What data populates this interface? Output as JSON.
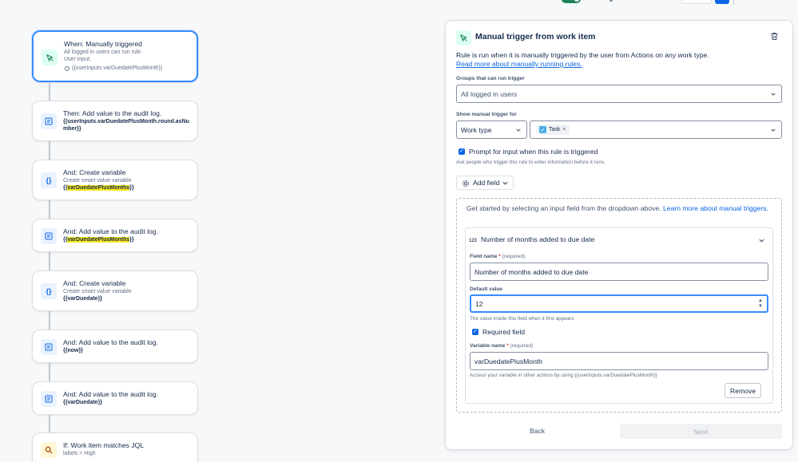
{
  "colors": {
    "accent": "#0c66e4",
    "selected_border": "#388bff",
    "highlight": "#f8e71c",
    "trigger_icon_bg": "#dcfff1",
    "action_icon_bg": "#e9f2ff",
    "condition_icon_bg": "#fff7d6"
  },
  "flow": {
    "cards": [
      {
        "icon": "trigger-icon",
        "title": "When: Manually triggered",
        "line1": "All logged in users can run rule.",
        "line2": "User input:",
        "bullet": "{{userInputs.varDuedatePlusMonth}}"
      },
      {
        "icon": "audit-log-icon",
        "title": "Then: Add value to the audit log.",
        "code": "{{userInputs.varDuedatePlusMonth.round.asNumber}}"
      },
      {
        "icon": "variable-icon",
        "title": "And: Create variable",
        "sub": "Create smart value variable",
        "code_pre": "{{",
        "code_hl": "varDuedatePlusMonths",
        "code_post": "}}"
      },
      {
        "icon": "audit-log-icon",
        "title": "And: Add value to the audit log.",
        "code_pre": "{{",
        "code_hl": "varDuedatePlusMonths",
        "code_post": "}}"
      },
      {
        "icon": "variable-icon",
        "title": "And: Create variable",
        "sub": "Create smart value variable",
        "code": "{{varDuedate}}"
      },
      {
        "icon": "audit-log-icon",
        "title": "And: Add value to the audit log.",
        "code": "{{now}}"
      },
      {
        "icon": "audit-log-icon",
        "title": "And: Add value to the audit log.",
        "code": "{{varDuedate}}"
      },
      {
        "icon": "search-condition-icon",
        "title": "If: Work item matches JQL",
        "sub": "labels = High"
      }
    ]
  },
  "panel": {
    "icon": "trigger-icon",
    "title": "Manual trigger from work item",
    "description": "Rule is run when it is manually triggered by the user from Actions on any work type.",
    "read_more_link": "Read more about manually running rules.",
    "groups_label": "Groups that can run trigger",
    "groups_value": "All logged in users",
    "show_for_label": "Show manual trigger for",
    "show_for_type": "Work type",
    "show_for_chip": "Task",
    "prompt_checkbox_label": "Prompt for input when this rule is triggered",
    "prompt_helper": "Ask people who trigger this rule to enter information before it runs.",
    "add_field_label": "Add field",
    "intro_text": "Get started by selecting an input field from the dropdown above.",
    "intro_link": "Learn more about manual triggers.",
    "field": {
      "type_icon": "123",
      "header": "Number of months added to due date",
      "name_label": "Field name",
      "name_required": "*",
      "name_optional": "(required)",
      "name_value": "Number of months added to due date",
      "default_label": "Default value",
      "default_value": "12",
      "default_helper": "The value inside this field when it first appears",
      "required_label": "Required field",
      "variable_label": "Variable name",
      "variable_required": "*",
      "variable_optional": "(required)",
      "variable_value": "varDuedatePlusMonth",
      "variable_helper": "Access your variable in other actions by using {{userInputs.varDuedatePlusMonth}}",
      "remove_label": "Remove"
    },
    "back_label": "Back",
    "next_label": "Next"
  }
}
